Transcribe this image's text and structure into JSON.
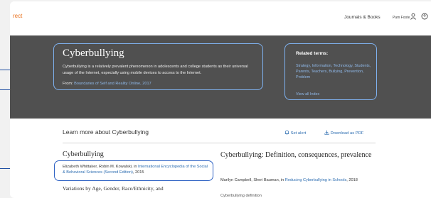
{
  "header": {
    "logo_text": "rect",
    "nav_link": "Journals & Books",
    "user_name": "Pam Foote"
  },
  "hero": {
    "title": "Cyberbullying",
    "description": "Cyberbullying is a relatively prevalent phenomenon in adolescents and college students as their universal usage of the Internet, especially using mobile devices to access to the Internet.",
    "from_label": "From:",
    "from_source": "Boundaries of Self and Reality Online, 2017",
    "related_title": "Related terms:",
    "related_terms": "Strategy, Information, Technology, Students, Parents, Teachers, Bullying, Prevention, Problem",
    "view_all": "View all Index"
  },
  "main": {
    "learn_title": "Learn more about Cyberbullying",
    "set_alert": "Set alert",
    "download": "Download as PDF",
    "articles": [
      {
        "title": "Cyberbullying",
        "authors": "Elizabeth Whittaker, Robin M. Kowalski, in",
        "source": "International Encyclopedia of the Social & Behavioral Sciences (Second Edition)",
        "year": ", 2015",
        "subtitle": "Variations by Age, Gender, Race/Ethnicity, and"
      },
      {
        "title": "Cyberbullying: Definition, consequences, prevalence",
        "authors": "Marilyn Campbell, Sheri Bauman, in",
        "source": "Reducing Cyberbullying in Schools",
        "year": ", 2018",
        "subtitle": "Cyberbullying definition"
      }
    ]
  },
  "colors": {
    "hero_bg": "#505050",
    "highlight_light": "#7fb2f0",
    "highlight_dark": "#2f63c4",
    "link": "#2b6cb0",
    "logo": "#e9711c"
  }
}
